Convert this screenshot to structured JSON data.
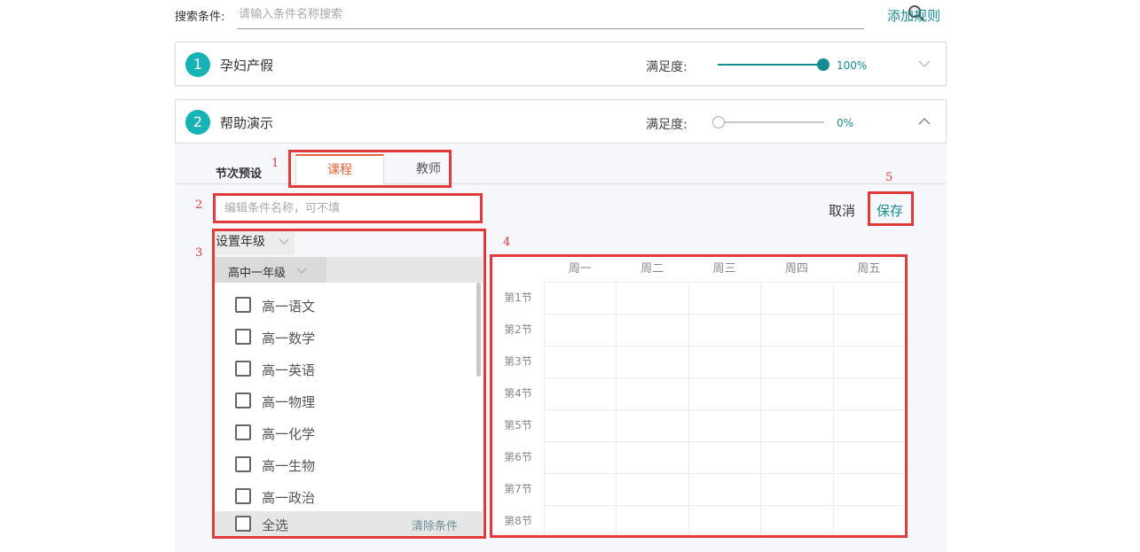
{
  "search": {
    "label": "搜索条件:",
    "placeholder": "请输入条件名称搜索",
    "value": ""
  },
  "add_rule": "添加规则",
  "rules": [
    {
      "number": "1",
      "title": "孕妇产假",
      "sat_label": "满足度:",
      "sat_value": "100%",
      "sat_fraction": 1.0,
      "expanded": false
    },
    {
      "number": "2",
      "title": "帮助演示",
      "sat_label": "满足度:",
      "sat_value": "0%",
      "sat_fraction": 0.0,
      "expanded": true
    }
  ],
  "editor": {
    "preset_label": "节次预设",
    "tabs": [
      {
        "label": "课程",
        "active": true
      },
      {
        "label": "教师",
        "active": false
      }
    ],
    "name_placeholder": "编辑条件名称，可不填",
    "cancel": "取消",
    "save": "保存",
    "grade_select": "设置年级",
    "grade_sub": "高中一年级",
    "courses": [
      "高一语文",
      "高一数学",
      "高一英语",
      "高一物理",
      "高一化学",
      "高一生物",
      "高一政治"
    ],
    "select_all": "全选",
    "clear": "清除条件",
    "timetable": {
      "days": [
        "周一",
        "周二",
        "周三",
        "周四",
        "周五"
      ],
      "periods": [
        "第1节",
        "第2节",
        "第3节",
        "第4节",
        "第5节",
        "第6节",
        "第7节",
        "第8节"
      ]
    }
  },
  "annotations": [
    "1",
    "2",
    "3",
    "4",
    "5"
  ],
  "colors": {
    "accent": "#1a8a95",
    "badge": "#16b2b6",
    "active_tab": "#e8623a",
    "annotation": "#e23a3a"
  }
}
